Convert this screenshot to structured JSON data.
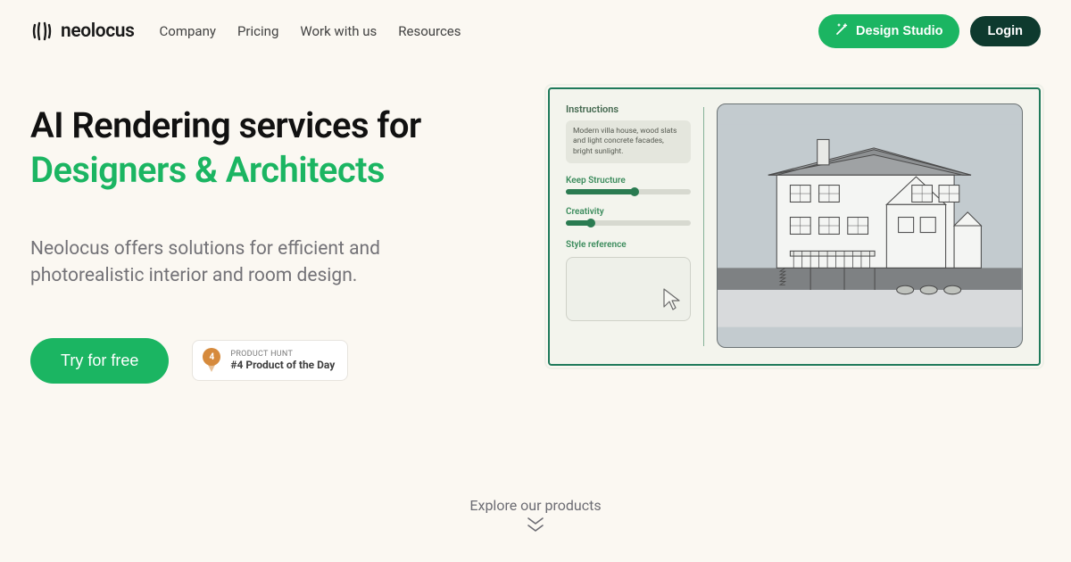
{
  "brand": {
    "name": "neolocus"
  },
  "nav": {
    "items": [
      "Company",
      "Pricing",
      "Work with us",
      "Resources"
    ]
  },
  "header_actions": {
    "design_studio": "Design Studio",
    "login": "Login"
  },
  "hero": {
    "title_line1": "AI Rendering services for",
    "title_accent": "Designers & Architects",
    "subtext": "Neolocus offers solutions for efficient and photorealistic interior and room design.",
    "cta": "Try for free"
  },
  "product_hunt": {
    "rank_number": "4",
    "line1": "PRODUCT HUNT",
    "line2": "#4 Product of the Day"
  },
  "demo": {
    "instructions_heading": "Instructions",
    "instructions_text": "Modern villa house, wood slats and light concrete facades, bright sunlight.",
    "slider1_label": "Keep Structure",
    "slider1_value_pct": 55,
    "slider2_label": "Creativity",
    "slider2_value_pct": 20,
    "style_heading": "Style reference"
  },
  "explore": {
    "label": "Explore our products"
  },
  "colors": {
    "green": "#1bb562",
    "dark_green": "#0e3a2e",
    "panel_border": "#1f7a5b"
  }
}
